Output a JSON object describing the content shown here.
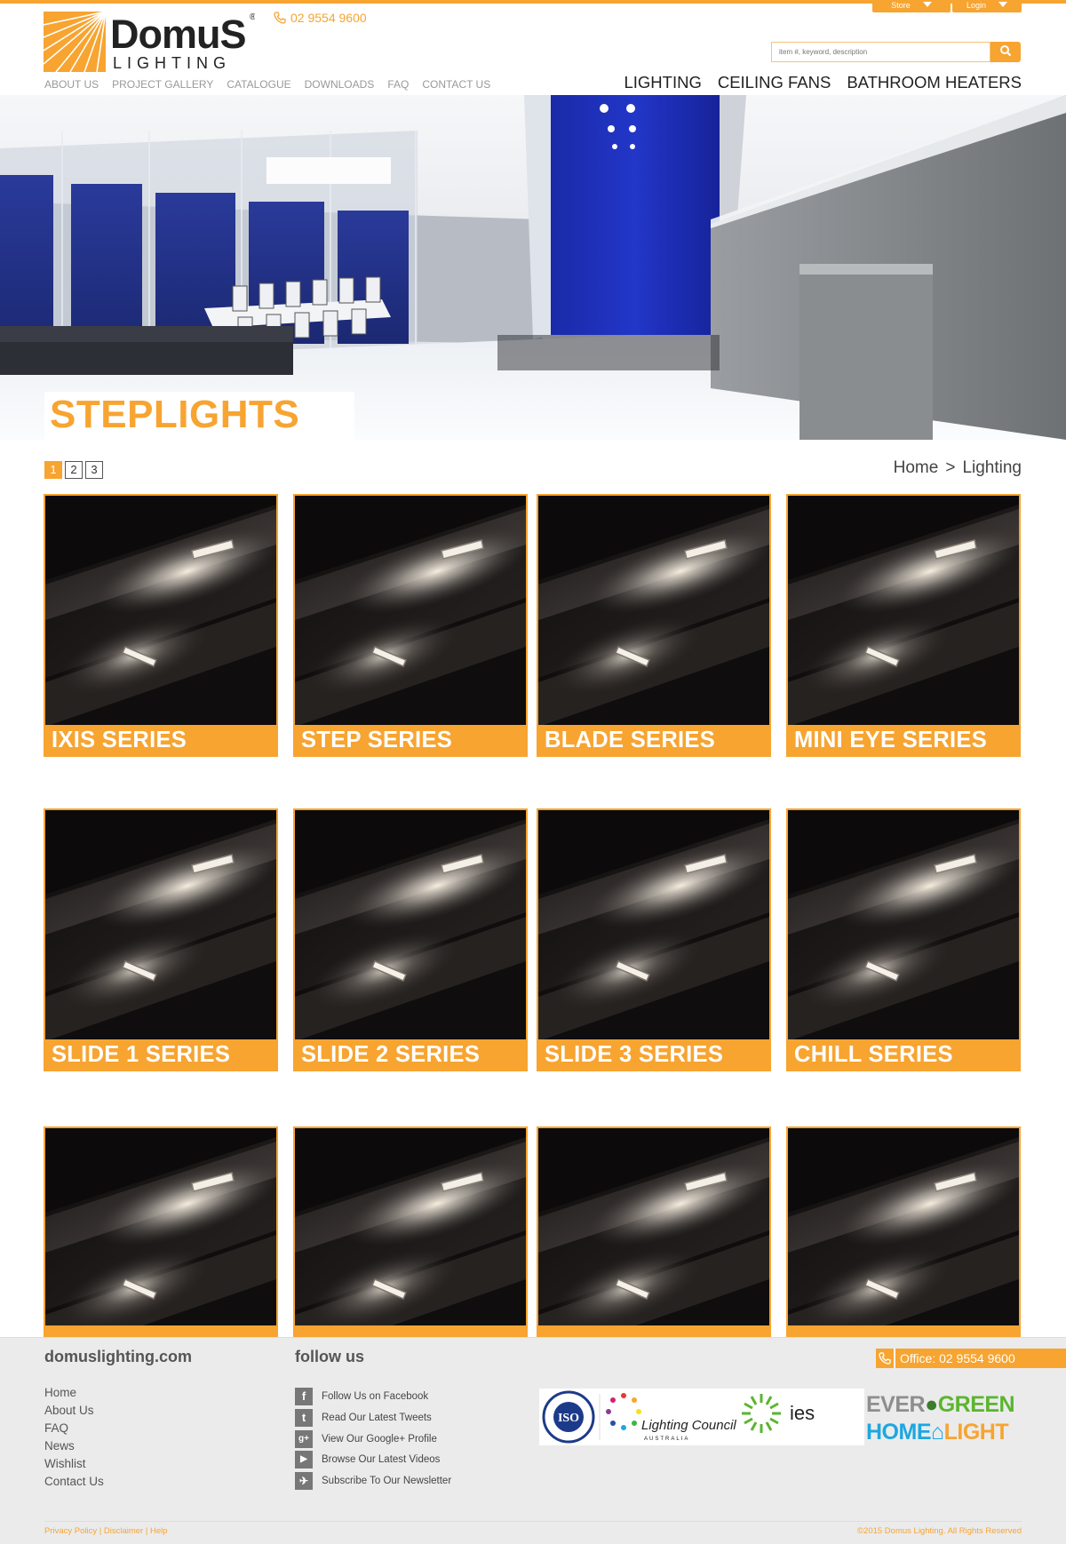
{
  "header": {
    "store_label": "Store",
    "login_label": "Login",
    "logo_name": "DomuS",
    "logo_tagline": "LIGHTING",
    "phone": "02 9554 9600",
    "search_placeholder": "item #, keyword, description",
    "subnav": [
      "ABOUT US",
      "PROJECT GALLERY",
      "CATALOGUE",
      "DOWNLOADS",
      "FAQ",
      "CONTACT US"
    ],
    "mainnav": [
      "LIGHTING",
      "CEILING FANS",
      "BATHROOM HEATERS"
    ]
  },
  "hero": {
    "title": "STEPLIGHTS"
  },
  "pagination": {
    "pages": [
      "1",
      "2",
      "3"
    ],
    "current": "1"
  },
  "breadcrumb": {
    "home": "Home",
    "separator": ">",
    "current": "Lighting"
  },
  "products": [
    {
      "label": "IXIS SERIES"
    },
    {
      "label": "STEP SERIES"
    },
    {
      "label": "BLADE SERIES"
    },
    {
      "label": "MINI EYE SERIES"
    },
    {
      "label": "SLIDE 1 SERIES"
    },
    {
      "label": "SLIDE 2 SERIES"
    },
    {
      "label": "SLIDE 3 SERIES"
    },
    {
      "label": "CHILL SERIES"
    },
    {
      "label": ""
    },
    {
      "label": ""
    },
    {
      "label": ""
    },
    {
      "label": ""
    }
  ],
  "footer": {
    "site": "domuslighting.com",
    "links": [
      "Home",
      "About Us",
      "FAQ",
      "News",
      "Wishlist",
      "Contact Us"
    ],
    "follow_title": "follow us",
    "social": [
      {
        "icon": "facebook-icon",
        "glyph": "f",
        "label": "Follow Us on Facebook"
      },
      {
        "icon": "twitter-icon",
        "glyph": "t",
        "label": "Read Our Latest Tweets"
      },
      {
        "icon": "google-plus-icon",
        "glyph": "g+",
        "label": "View Our Google+ Profile"
      },
      {
        "icon": "youtube-icon",
        "glyph": "▶",
        "label": "Browse Our Latest Videos"
      },
      {
        "icon": "newsletter-icon",
        "glyph": "✈",
        "label": "Subscribe To Our Newsletter"
      }
    ],
    "office": "Office: 02 9554 9600",
    "cert_iso": "ISO",
    "cert_lighting_council": "Lighting Council",
    "cert_lighting_council_sub": "AUSTRALIA",
    "cert_ies": "ies",
    "ever_a": "EVER",
    "ever_b": "GREEN",
    "home_a": "HOME",
    "home_b": "LIGHT",
    "legal": "Privacy Policy | Disclaimer | Help",
    "copyright": "©2015 Domus Lighting. All Rights Reserved"
  },
  "colors": {
    "accent": "#f7a431",
    "footer_bg": "#ebebeb"
  }
}
